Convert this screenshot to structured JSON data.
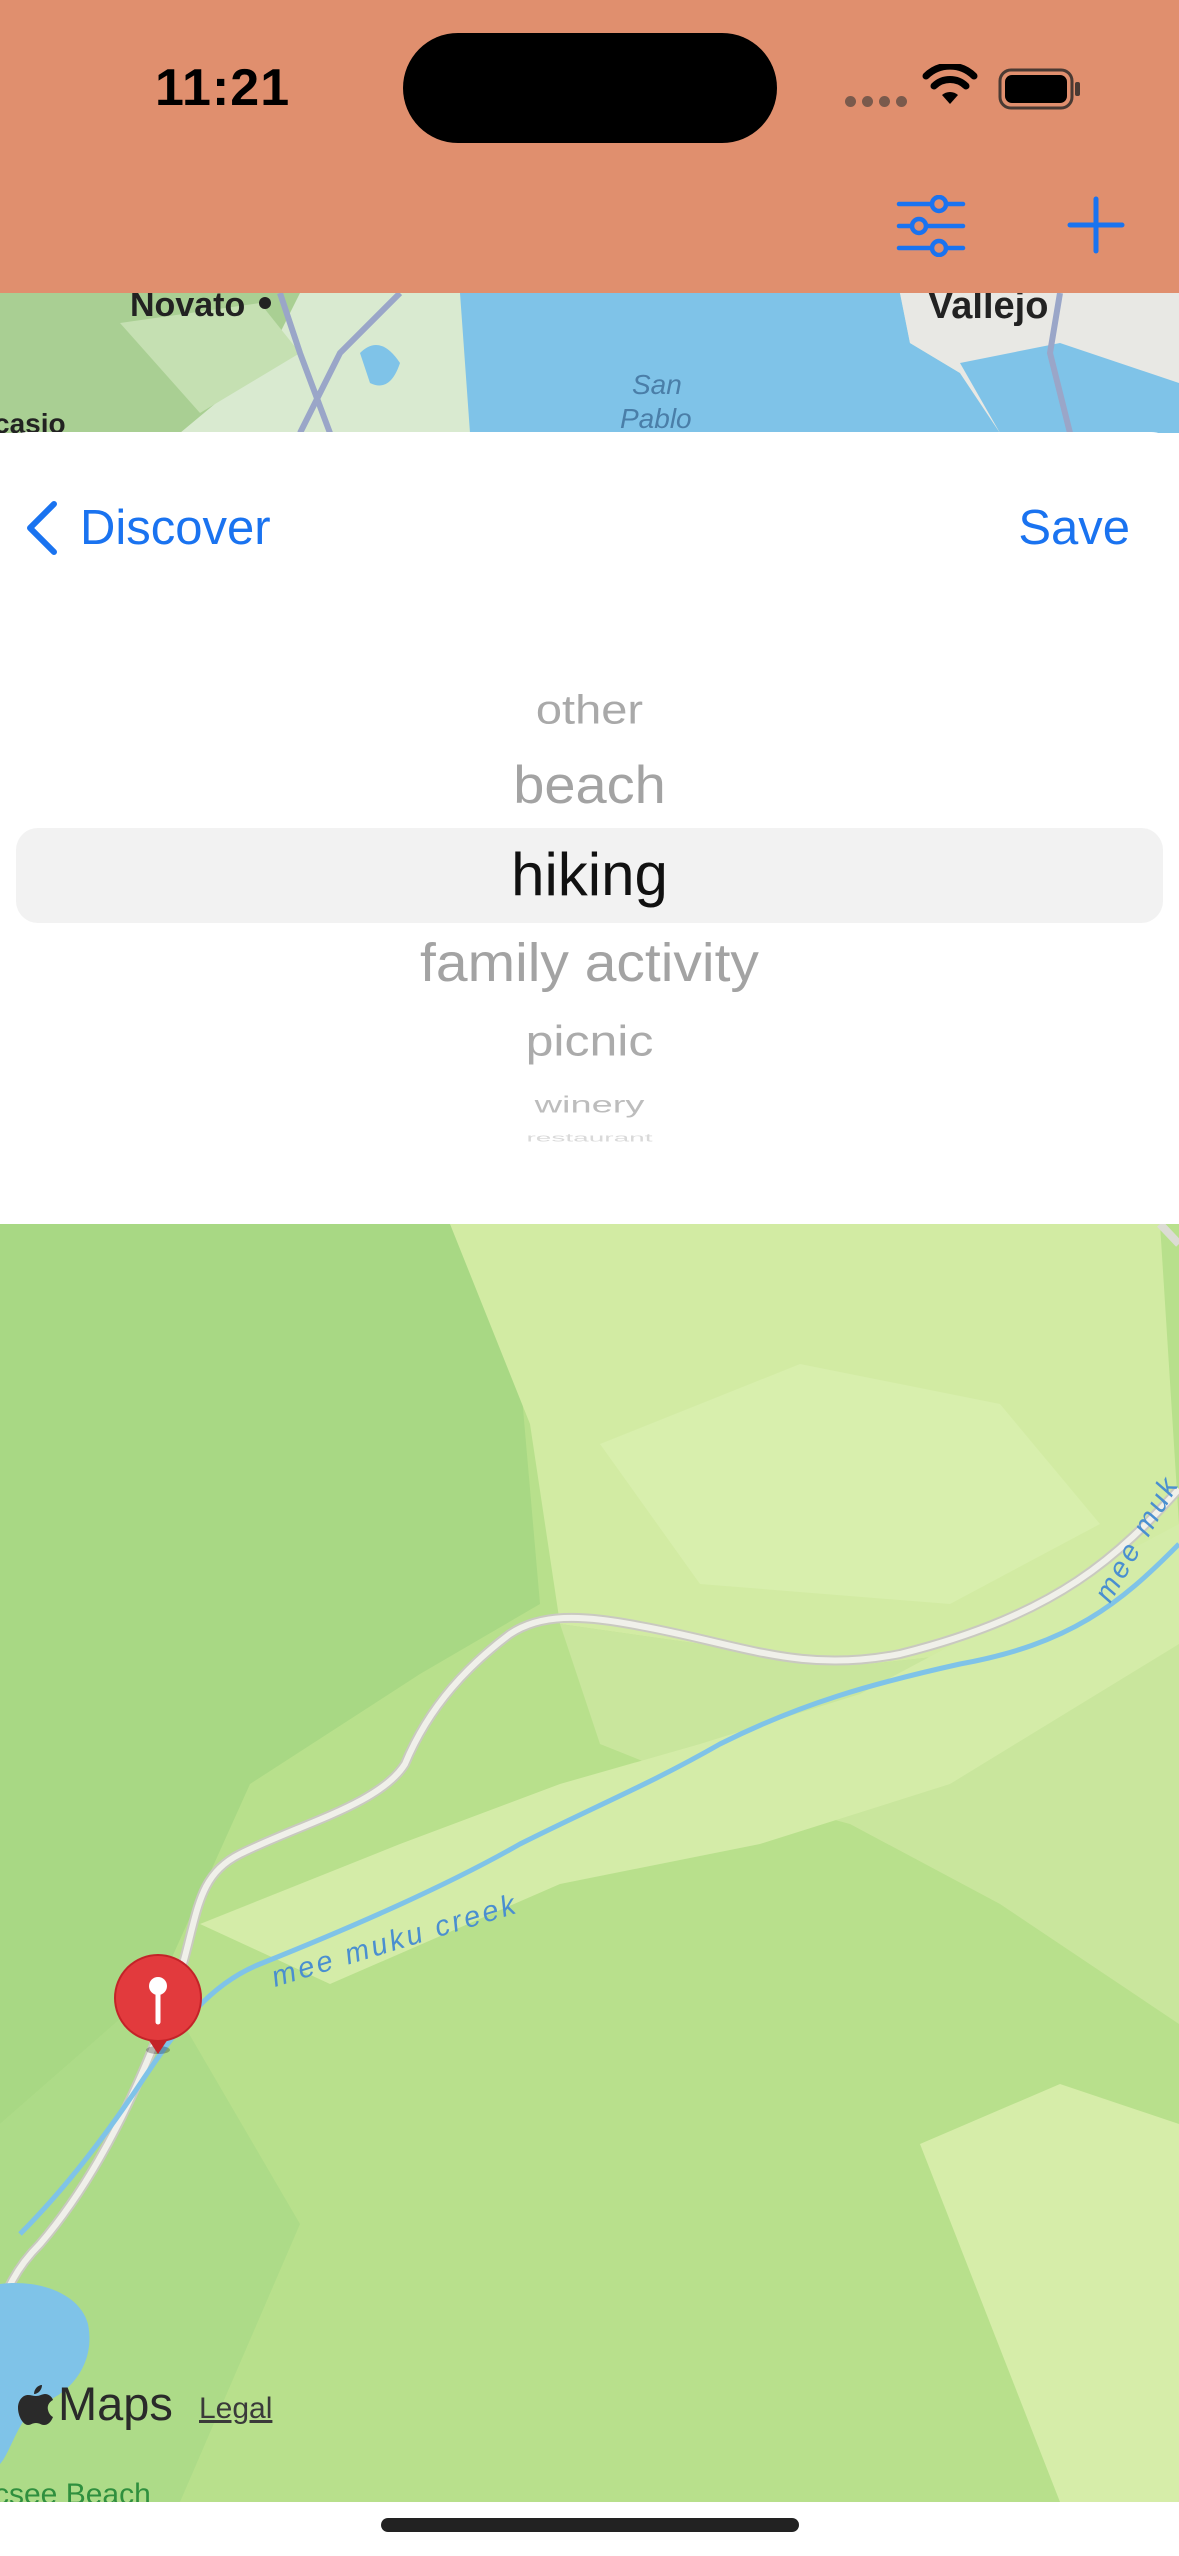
{
  "status_bar": {
    "time": "11:21",
    "icons": [
      "cellular-signal-icon",
      "wifi-icon",
      "battery-icon"
    ]
  },
  "toolbar": {
    "actions": [
      "filter-sliders-icon",
      "add-plus-icon"
    ]
  },
  "top_map": {
    "labels": {
      "novato": "Novato",
      "vallejo": "Vallejo",
      "san": "San",
      "pablo": "Pablo",
      "nicasio": "casio"
    }
  },
  "sheet": {
    "back_label": "Discover",
    "save_label": "Save",
    "picker": {
      "options": [
        "other",
        "beach",
        "hiking",
        "family activity",
        "picnic",
        "winery",
        "restaurant"
      ],
      "selected": "hiking"
    }
  },
  "map": {
    "creek_label_1": "mee muku creek",
    "creek_label_2": "mee muk",
    "maps_label": "Maps",
    "legal_label": "Legal",
    "bottom_label": "csee Beach"
  },
  "colors": {
    "nav_background": "#E08F6E",
    "accent_blue": "#1a73f0",
    "pin_red": "#e23a3d",
    "map_green": "#b9e48c",
    "water_blue": "#7fc3e8"
  }
}
